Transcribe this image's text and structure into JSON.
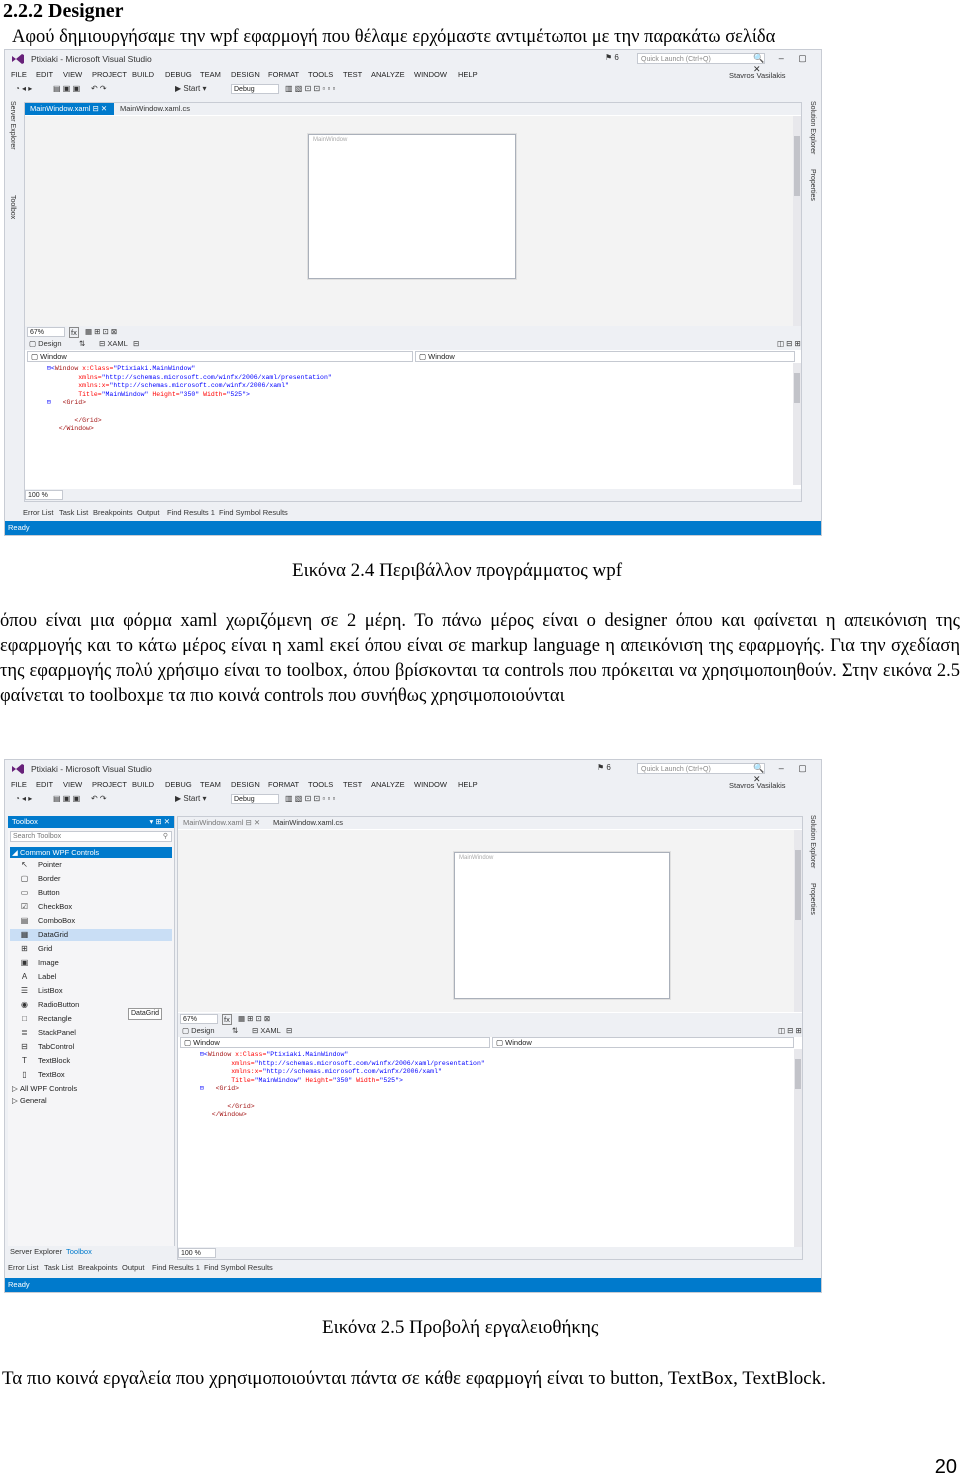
{
  "heading": "2.2.2 Designer",
  "intro": "Αφού δημιουργήσαμε την wpf εφαρμογή που θέλαμε ερχόμαστε αντιμέτωποι με την παρακάτω σελίδα",
  "caption1": "Εικόνα 2.4 Περιβάλλον προγράμματος wpf",
  "para2": "όπου είναι μια φόρμα xaml χωριζόμενη σε 2 μέρη. Το πάνω μέρος είναι ο designer όπου και φαίνεται η απεικόνιση της εφαρμογής και το κάτω μέρος είναι η xaml εκεί όπου είναι σε markup language η απεικόνιση της εφαρμογής. Για την σχεδίαση της εφαρμογής πολύ χρήσιμο είναι το toolbox, όπου βρίσκονται τα controls που πρόκειται να χρησιμοποιηθούν. Στην εικόνα 2.5 φαίνεται το toolboxμε τα πιο κοινά controls που συνήθως χρησιμοποιούνται",
  "caption2": "Εικόνα 2.5 Προβολή εργαλειοθήκης",
  "para3": "Τα πιο κοινά εργαλεία που χρησιμοποιούνται πάντα σε κάθε εφαρμογή είναι το button, TextBox, TextBlock.",
  "page_number": "20",
  "vs": {
    "title": "Ptixiaki - Microsoft Visual Studio",
    "quick_launch": "Quick Launch (Ctrl+Q)",
    "notif_count": "6",
    "user": "Stavros Vasilakis",
    "menu": [
      "FILE",
      "EDIT",
      "VIEW",
      "PROJECT",
      "BUILD",
      "DEBUG",
      "TEAM",
      "DESIGN",
      "FORMAT",
      "TOOLS",
      "TEST",
      "ANALYZE",
      "WINDOW",
      "HELP"
    ],
    "start": "Start",
    "config": "Debug",
    "tab_active": "MainWindow.xaml",
    "tab_inactive": "MainWindow.xaml.cs",
    "window_title": "MainWindow",
    "zoom": "67%",
    "fx": "fx",
    "design_tab": "Design",
    "xaml_tab": "XAML",
    "left_selector": "Window",
    "right_selector": "Window",
    "code_zoom": "100 %",
    "code": {
      "l1_open": "<",
      "l1_tag": "Window",
      "l1_attr": " x:Class=",
      "l1_val": "\"Ptixiaki.MainWindow\"",
      "l2_attr": "xmlns=",
      "l2_val": "\"http://schemas.microsoft.com/winfx/2006/xaml/presentation\"",
      "l3_attr": "xmlns:x=",
      "l3_val": "\"http://schemas.microsoft.com/winfx/2006/xaml\"",
      "l4_attr1": "Title=",
      "l4_val1": "\"MainWindow\"",
      "l4_attr2": " Height=",
      "l4_val2": "\"350\"",
      "l4_attr3": " Width=",
      "l4_val3": "\"525\"",
      "l4_close": ">",
      "l5": "<Grid>",
      "l6": "</Grid>",
      "l7": "</Window>"
    },
    "bottom_tabs": [
      "Error List",
      "Task List",
      "Breakpoints",
      "Output",
      "Find Results 1",
      "Find Symbol Results"
    ],
    "status": "Ready",
    "left_side": [
      "Server Explorer",
      "Toolbox"
    ],
    "right_side": [
      "Solution Explorer",
      "Properties"
    ],
    "left_panel_tabs": [
      "Server Explorer",
      "Toolbox"
    ],
    "toolbox": {
      "title": "Toolbox",
      "pin": "▾ ⊞ ✕",
      "search": "Search Toolbox",
      "group": "Common WPF Controls",
      "items": [
        {
          "icon": "arrow-pointer-icon",
          "glyph": "↖",
          "label": "Pointer"
        },
        {
          "icon": "border-icon",
          "glyph": "▢",
          "label": "Border"
        },
        {
          "icon": "button-icon",
          "glyph": "▭",
          "label": "Button"
        },
        {
          "icon": "checkbox-icon",
          "glyph": "☑",
          "label": "CheckBox"
        },
        {
          "icon": "combobox-icon",
          "glyph": "▤",
          "label": "ComboBox"
        },
        {
          "icon": "datagrid-icon",
          "glyph": "▦",
          "label": "DataGrid"
        },
        {
          "icon": "grid-icon",
          "glyph": "⊞",
          "label": "Grid"
        },
        {
          "icon": "image-icon",
          "glyph": "▣",
          "label": "Image"
        },
        {
          "icon": "label-icon",
          "glyph": "A",
          "label": "Label"
        },
        {
          "icon": "listbox-icon",
          "glyph": "☰",
          "label": "ListBox"
        },
        {
          "icon": "radiobutton-icon",
          "glyph": "◉",
          "label": "RadioButton"
        },
        {
          "icon": "rectangle-icon",
          "glyph": "□",
          "label": "Rectangle"
        },
        {
          "icon": "stackpanel-icon",
          "glyph": "≣",
          "label": "StackPanel"
        },
        {
          "icon": "tabcontrol-icon",
          "glyph": "⊟",
          "label": "TabControl"
        },
        {
          "icon": "textblock-icon",
          "glyph": "T",
          "label": "TextBlock"
        },
        {
          "icon": "textbox-icon",
          "glyph": "▯",
          "label": "TextBox"
        }
      ],
      "group2": "All WPF Controls",
      "group3": "General",
      "tooltip": "DataGrid"
    }
  }
}
